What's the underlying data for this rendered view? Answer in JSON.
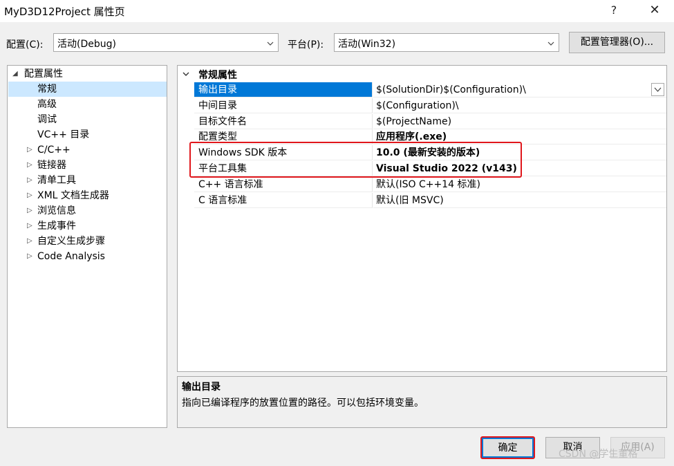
{
  "window": {
    "title": "MyD3D12Project 属性页",
    "help_label": "?",
    "close_label": "✕"
  },
  "toolbar": {
    "config_label": "配置(C):",
    "config_value": "活动(Debug)",
    "platform_label": "平台(P):",
    "platform_value": "活动(Win32)",
    "config_manager_label": "配置管理器(O)..."
  },
  "tree": {
    "root": "配置属性",
    "items": [
      {
        "label": "常规",
        "expandable": false,
        "selected": true
      },
      {
        "label": "高级",
        "expandable": false
      },
      {
        "label": "调试",
        "expandable": false
      },
      {
        "label": "VC++ 目录",
        "expandable": false
      },
      {
        "label": "C/C++",
        "expandable": true
      },
      {
        "label": "链接器",
        "expandable": true
      },
      {
        "label": "清单工具",
        "expandable": true
      },
      {
        "label": "XML 文档生成器",
        "expandable": true
      },
      {
        "label": "浏览信息",
        "expandable": true
      },
      {
        "label": "生成事件",
        "expandable": true
      },
      {
        "label": "自定义生成步骤",
        "expandable": true
      },
      {
        "label": "Code Analysis",
        "expandable": true
      }
    ]
  },
  "grid": {
    "category": "常规属性",
    "rows": [
      {
        "name": "输出目录",
        "value": "$(SolutionDir)$(Configuration)\\"
      },
      {
        "name": "中间目录",
        "value": "$(Configuration)\\"
      },
      {
        "name": "目标文件名",
        "value": "$(ProjectName)"
      },
      {
        "name": "配置类型",
        "value": "应用程序(.exe)"
      },
      {
        "name": "Windows SDK 版本",
        "value": "10.0 (最新安装的版本)"
      },
      {
        "name": "平台工具集",
        "value": "Visual Studio 2022 (v143)"
      },
      {
        "name": "C++ 语言标准",
        "value": "默认(ISO C++14 标准)"
      },
      {
        "name": "C 语言标准",
        "value": "默认(旧 MSVC)"
      }
    ]
  },
  "description": {
    "title": "输出目录",
    "text": "指向已编译程序的放置位置的路径。可以包括环境变量。"
  },
  "buttons": {
    "ok": "确定",
    "cancel": "取消",
    "apply": "应用(A)"
  },
  "watermark": "CSDN @学生董格",
  "colors": {
    "selection": "#0078d7",
    "tree_selection": "#cce8ff",
    "highlight": "#e0161b"
  }
}
